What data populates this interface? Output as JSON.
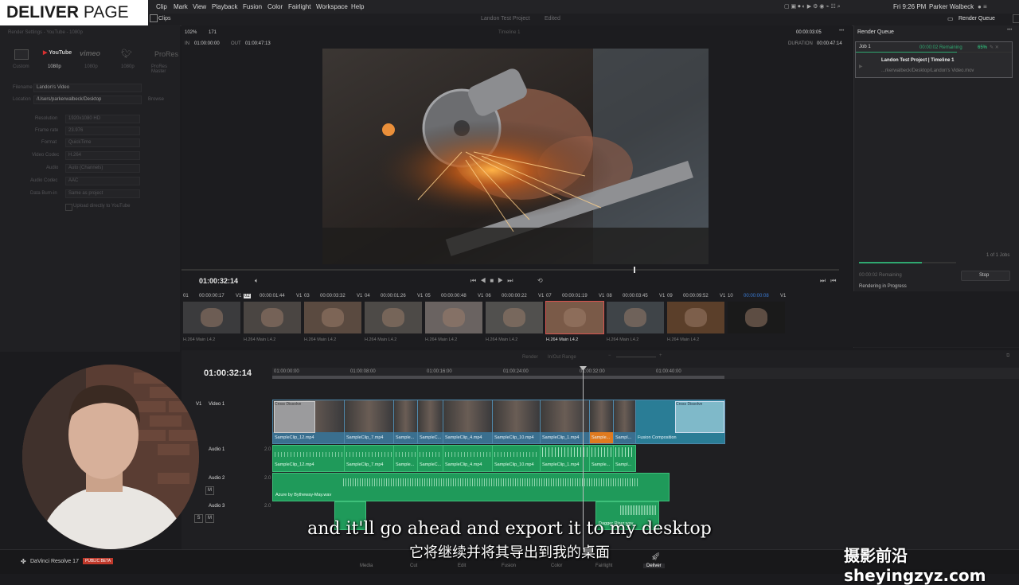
{
  "overlay_title": {
    "bold": "DELIVER",
    "light": "PAGE"
  },
  "menubar": {
    "items": [
      "Clip",
      "Mark",
      "View",
      "Playback",
      "Fusion",
      "Color",
      "Fairlight",
      "Workspace",
      "Help"
    ],
    "clock": "Fri 9:26 PM",
    "user": "Parker Walbeck"
  },
  "toolbar": {
    "clips_label": "Clips",
    "project_title": "Landon Test Project",
    "project_status": "Edited",
    "render_queue_label": "Render Queue"
  },
  "render_settings": {
    "header": "Render Settings - YouTube - 1080p",
    "presets": [
      {
        "name": "Custom",
        "icon": "custom-preset-icon"
      },
      {
        "name": "YouTube",
        "sub": "1080p",
        "icon": "youtube-logo"
      },
      {
        "name": "vimeo",
        "sub": "1080p",
        "icon": "vimeo-logo"
      },
      {
        "name": "",
        "sub": "1080p",
        "icon": "twitter-logo"
      },
      {
        "name": "ProRes",
        "sub": "ProRes Master",
        "icon": "prores-preset-icon"
      }
    ],
    "filename_label": "Filename",
    "filename_value": "Landon's Video",
    "location_label": "Location",
    "location_value": "/Users/parkerwalbeck/Desktop",
    "browse_label": "Browse",
    "fields": [
      {
        "label": "Resolution",
        "value": "1920x1080 HD"
      },
      {
        "label": "Frame rate",
        "value": "23.976"
      },
      {
        "label": "Format",
        "value": "QuickTime"
      },
      {
        "label": "Video Codec",
        "value": "H.264"
      },
      {
        "label": "Audio",
        "value": "Auto (Channels)"
      },
      {
        "label": "Audio Codec",
        "value": "AAC"
      },
      {
        "label": "Data Burn-in",
        "value": "Same as project"
      }
    ],
    "upload_label": "Upload directly to YouTube"
  },
  "viewer": {
    "zoom": "102%",
    "frame": "171",
    "timeline_name": "Timeline 1",
    "timecode_top": "00:00:03:05",
    "in_label": "IN",
    "in_tc": "01:00:00:00",
    "out_label": "OUT",
    "out_tc": "01:00:47:13",
    "duration_label": "DURATION",
    "duration_tc": "00:00:47:14",
    "current_tc": "01:00:32:14"
  },
  "render_queue": {
    "title": "Render Queue",
    "job_label": "Job 1",
    "job_remaining": "00:00:02 Remaining",
    "job_percent": "65%",
    "job_progress": 0.65,
    "job_title": "Landon Test Project | Timeline 1",
    "job_path": "...rkerwalbeck/Desktop/Landon's Video.mov",
    "progress_label": "Rendering in Progress",
    "progress_count": "1 of 1 Jobs",
    "progress_fraction": 0.65,
    "remaining_label": "00:00:02 Remaining",
    "stop_label": "Stop"
  },
  "clips": [
    {
      "num": "01",
      "tc": "00:00:00:17",
      "track": "V1",
      "codec": "H.264 Main L4.2"
    },
    {
      "num": "02",
      "tc": "00:00:01:44",
      "track": "V1",
      "codec": "H.264 Main L4.2"
    },
    {
      "num": "03",
      "tc": "00:00:03:32",
      "track": "V1",
      "codec": "H.264 Main L4.2"
    },
    {
      "num": "04",
      "tc": "00:00:01:26",
      "track": "V1",
      "codec": "H.264 Main L4.2"
    },
    {
      "num": "05",
      "tc": "00:00:00:48",
      "track": "V1",
      "codec": "H.264 Main L4.2"
    },
    {
      "num": "06",
      "tc": "00:00:00:22",
      "track": "V1",
      "codec": "H.264 Main L4.2"
    },
    {
      "num": "07",
      "tc": "00:00:01:19",
      "track": "V1",
      "codec": "H.264 Main L4.2"
    },
    {
      "num": "08",
      "tc": "00:00:03:45",
      "track": "V1",
      "codec": "H.264 Main L4.2"
    },
    {
      "num": "09",
      "tc": "00:00:09:52",
      "track": "V1",
      "codec": "H.264 Main L4.2"
    },
    {
      "num": "10",
      "tc": "00:00:00:08",
      "track": "V1",
      "codec": ""
    }
  ],
  "timeline": {
    "current_tc": "01:00:32:14",
    "ruler": [
      "01:00:00:00",
      "01:00:08:00",
      "01:00:16:00",
      "01:00:24:00",
      "01:00:32:00",
      "01:00:40:00"
    ],
    "ghost_label_1": "Render",
    "ghost_label_2": "In/Out Range",
    "tracks": [
      {
        "id": "V1",
        "name": "Video 1"
      },
      {
        "id": "A1",
        "name": "Audio 1",
        "ch": "2.0"
      },
      {
        "id": "A2",
        "name": "Audio 2",
        "ch": "2.0"
      },
      {
        "id": "A3",
        "name": "Audio 3",
        "ch": "2.0"
      }
    ],
    "video_clips": [
      "SampleClip_12.mp4",
      "SampleClip_7.mp4",
      "Sample...",
      "SampleC...",
      "SampleClip_4.mp4",
      "SampleClip_10.mp4",
      "SampleClip_1.mp4",
      "Sample...",
      "Sampl...",
      "Fusion Composition"
    ],
    "transition_1": "Cross Dissolve",
    "transition_2": "Cross Dissolve",
    "audio1_clips": [
      "SampleClip_12.mp4",
      "SampleClip_7.mp4",
      "Sample...",
      "SampleC...",
      "SampleClip_4.mp4",
      "SampleClip_10.mp4",
      "SampleClip_1.mp4",
      "Sample...",
      "Sampl..."
    ],
    "audio2_clip": "Azure by Bytheway-May.wav",
    "audio3_clip": "Dagger Riser.wav",
    "mute": "M",
    "solo": "S"
  },
  "bottom": {
    "app_name": "DaVinci Resolve 17",
    "beta_badge": "PUBLIC BETA",
    "tabs": [
      "Media",
      "Cut",
      "Edit",
      "Fusion",
      "Color",
      "Fairlight",
      "Deliver"
    ],
    "active_tab": "Deliver"
  },
  "subtitles": {
    "en": "and it'll go ahead and export it to my desktop",
    "zh": "它将继续并将其导出到我的桌面"
  },
  "watermark": "摄影前沿 sheyingzyz.com",
  "colors": {
    "video_clip": "#3a6f8f",
    "audio_clip": "#1f9a5a",
    "accent_orange": "#e07a1f",
    "progress_green": "#2fa870",
    "playhead": "#9a9a9a",
    "selected_clip": "#d9534f"
  }
}
